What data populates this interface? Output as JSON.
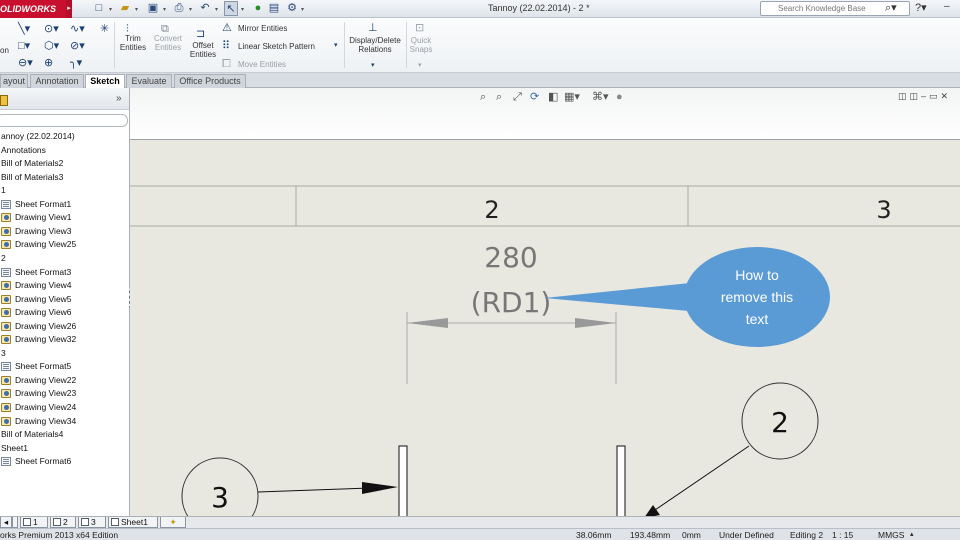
{
  "app": {
    "logo_text": "OLIDWORKS",
    "title": "Tannoy (22.02.2014) - 2 *"
  },
  "quick_access": {
    "icons": [
      "new-icon",
      "open-icon",
      "save-icon",
      "print-icon",
      "undo-icon",
      "select-icon",
      "rebuild-icon",
      "file-properties-icon",
      "options-icon"
    ]
  },
  "search": {
    "placeholder": "Search Knowledge Base"
  },
  "ribbon": {
    "trim_entities": "Trim\nEntities",
    "convert_entities": "Convert\nEntities",
    "offset_entities": "Offset\nEntities",
    "mirror_entities": "Mirror Entities",
    "linear_sketch_pattern": "Linear Sketch Pattern",
    "move_entities": "Move Entities",
    "display_delete_relations": "Display/Delete\nRelations",
    "quick_snaps": "Quick\nSnaps",
    "smart_dim_partial": "on"
  },
  "tabs": [
    {
      "label": "ayout",
      "active": false
    },
    {
      "label": "Annotation",
      "active": false
    },
    {
      "label": "Sketch",
      "active": true
    },
    {
      "label": "Evaluate",
      "active": false
    },
    {
      "label": "Office Products",
      "active": false
    }
  ],
  "tree": {
    "items": [
      {
        "label": "annoy (22.02.2014)",
        "indent": 0,
        "icon": "none"
      },
      {
        "label": "Annotations",
        "indent": 1,
        "icon": "none"
      },
      {
        "label": "Bill of Materials2",
        "indent": 1,
        "icon": "none"
      },
      {
        "label": "Bill of Materials3",
        "indent": 1,
        "icon": "none"
      },
      {
        "label": "1",
        "indent": 1,
        "icon": "none"
      },
      {
        "label": "Sheet Format1",
        "indent": 2,
        "icon": "fmt"
      },
      {
        "label": "Drawing View1",
        "indent": 2,
        "icon": "view"
      },
      {
        "label": "Drawing View3",
        "indent": 2,
        "icon": "view"
      },
      {
        "label": "Drawing View25",
        "indent": 2,
        "icon": "view"
      },
      {
        "label": "2",
        "indent": 1,
        "icon": "none"
      },
      {
        "label": "Sheet Format3",
        "indent": 2,
        "icon": "fmt"
      },
      {
        "label": "Drawing View4",
        "indent": 2,
        "icon": "view"
      },
      {
        "label": "Drawing View5",
        "indent": 2,
        "icon": "view"
      },
      {
        "label": "Drawing View6",
        "indent": 2,
        "icon": "view"
      },
      {
        "label": "Drawing View26",
        "indent": 2,
        "icon": "view"
      },
      {
        "label": "Drawing View32",
        "indent": 2,
        "icon": "view"
      },
      {
        "label": "3",
        "indent": 1,
        "icon": "none"
      },
      {
        "label": "Sheet Format5",
        "indent": 2,
        "icon": "fmt"
      },
      {
        "label": "Drawing View22",
        "indent": 2,
        "icon": "view"
      },
      {
        "label": "Drawing View23",
        "indent": 2,
        "icon": "view"
      },
      {
        "label": "Drawing View24",
        "indent": 2,
        "icon": "view"
      },
      {
        "label": "Drawing View34",
        "indent": 2,
        "icon": "view"
      },
      {
        "label": "Bill of Materials4",
        "indent": 1,
        "icon": "none"
      },
      {
        "label": "Sheet1",
        "indent": 1,
        "icon": "none"
      },
      {
        "label": "Sheet Format6",
        "indent": 2,
        "icon": "fmt"
      }
    ]
  },
  "drawing": {
    "zone_2": "2",
    "zone_3": "3",
    "dimension_value": "280",
    "dimension_ref": "(RD1)",
    "balloon_left": "3",
    "balloon_right": "2",
    "callout_text_line1": "How to",
    "callout_text_line2": "remove this",
    "callout_text_line3": "text",
    "callout_color": "#5b9bd5"
  },
  "sheet_tabs": [
    {
      "label": "1"
    },
    {
      "label": "2"
    },
    {
      "label": "3"
    },
    {
      "label": "Sheet1"
    }
  ],
  "status": {
    "edition": "orks Premium 2013 x64 Edition",
    "x": "38.06mm",
    "y": "193.48mm",
    "z": "0mm",
    "state": "Under Defined",
    "editing": "Editing 2",
    "scale": "1 : 15",
    "units": "MMGS"
  }
}
